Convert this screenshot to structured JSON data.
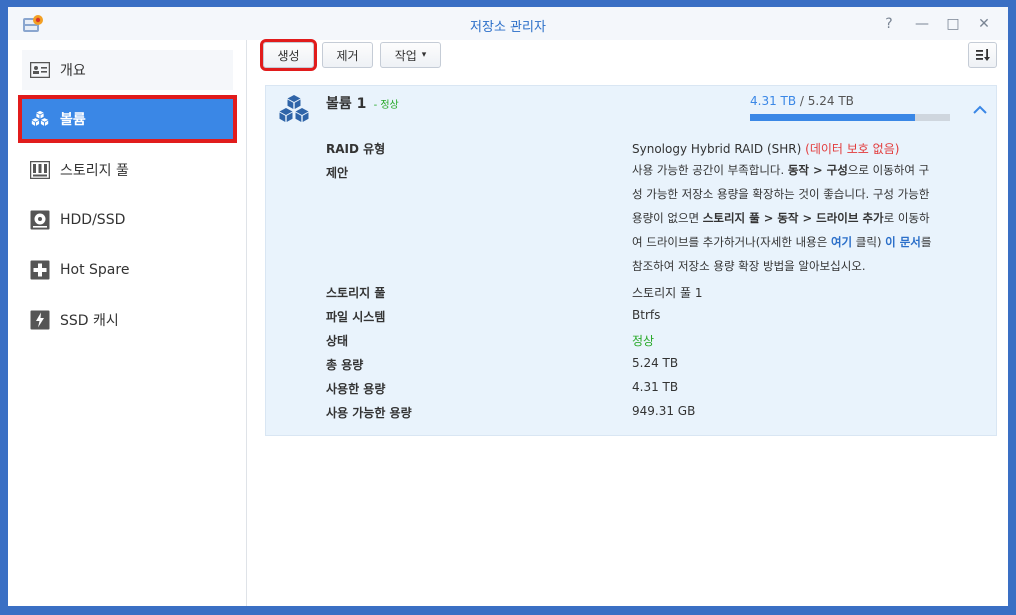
{
  "window": {
    "title": "저장소 관리자",
    "controls": [
      "?",
      "—",
      "□",
      "✕"
    ]
  },
  "sidebar": {
    "items": [
      {
        "label": "개요",
        "icon": "overview-icon"
      },
      {
        "label": "볼륨",
        "icon": "volume-icon"
      },
      {
        "label": "스토리지 풀",
        "icon": "storage-pool-icon"
      },
      {
        "label": "HDD/SSD",
        "icon": "hdd-icon"
      },
      {
        "label": "Hot Spare",
        "icon": "hot-spare-icon"
      },
      {
        "label": "SSD 캐시",
        "icon": "ssd-cache-icon"
      }
    ],
    "selected": "볼륨"
  },
  "toolbar": {
    "create_label": "생성",
    "remove_label": "제거",
    "action_label": "작업",
    "action_caret": "▾",
    "sort_icon": "sort-icon"
  },
  "volume": {
    "name": "볼륨 1",
    "status_sep": " - ",
    "status": "정상",
    "used": "4.31 TB",
    "usage_sep": " / ",
    "total": "5.24 TB",
    "used_fraction": 0.823,
    "details": {
      "raid_label": "RAID 유형",
      "raid_value": "Synology Hybrid RAID (SHR)",
      "raid_warning": "(데이터 보호 없음)",
      "suggestion_label": "제안",
      "suggestion": {
        "p1": "사용 가능한 공간이 부족합니다. ",
        "b1": "동작 > 구성",
        "p2": "으로 이동하여 구성 가능한 저장소 용량을 확장하는 것이 좋습니다. 구성 가능한 용량이 없으면 ",
        "b2": "스토리지 풀 > 동작 > 드라이브 추가",
        "p3": "로 이동하여 드라이브를 추가하거나(자세한 내용은 ",
        "link1": "여기",
        "p4": " 클릭) ",
        "link2": "이 문서",
        "p5": "를 참조하여 저장소 용량 확장 방법을 알아보십시오."
      },
      "pool_label": "스토리지 풀",
      "pool_value": "스토리지 풀 1",
      "fs_label": "파일 시스템",
      "fs_value": "Btrfs",
      "state_label": "상태",
      "state_value": "정상",
      "total_label": "총 용량",
      "total_value": "5.24 TB",
      "used_label": "사용한 용량",
      "used_value": "4.31 TB",
      "avail_label": "사용 가능한 용량",
      "avail_value": "949.31 GB"
    }
  },
  "colors": {
    "accent": "#3a87e6",
    "highlight": "#e11c1c",
    "ok": "#27a827",
    "warning": "#e23b3b",
    "desktop": "#3a6fc4"
  }
}
